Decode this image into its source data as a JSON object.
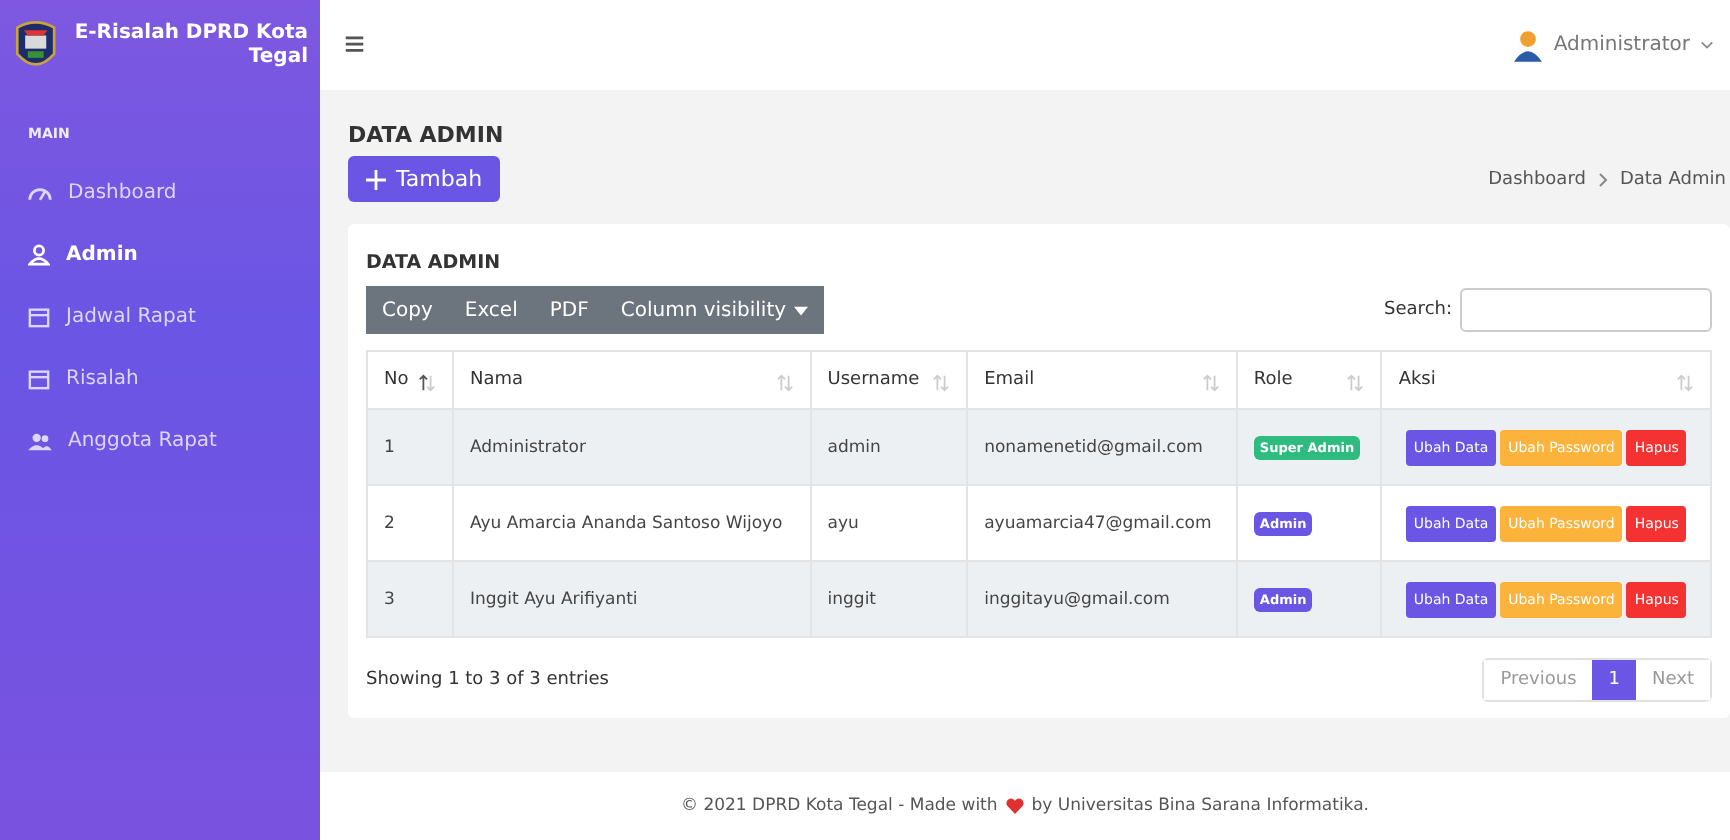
{
  "sidebar": {
    "brand": "E-Risalah DPRD Kota Tegal",
    "section": "MAIN",
    "items": [
      {
        "label": "Dashboard",
        "selected": false
      },
      {
        "label": "Admin",
        "selected": true
      },
      {
        "label": "Jadwal Rapat",
        "selected": false
      },
      {
        "label": "Risalah",
        "selected": false
      },
      {
        "label": "Anggota Rapat",
        "selected": false
      }
    ]
  },
  "topbar": {
    "menu_icon": "≡",
    "user": "Administrator"
  },
  "page": {
    "title": "DATA ADMIN",
    "add_button": "Tambah",
    "breadcrumb": [
      "Dashboard",
      "Data Admin"
    ]
  },
  "card": {
    "title": "DATA ADMIN",
    "export_buttons": [
      "Copy",
      "Excel",
      "PDF",
      "Column visibility"
    ],
    "search_label": "Search:",
    "columns": [
      {
        "label": "No",
        "sorted": true
      },
      {
        "label": "Nama",
        "sorted": false
      },
      {
        "label": "Username",
        "sorted": false
      },
      {
        "label": "Email",
        "sorted": false
      },
      {
        "label": "Role",
        "sorted": false
      },
      {
        "label": "Aksi",
        "sorted": false
      }
    ],
    "rows": [
      {
        "no": "1",
        "nama": "Administrator",
        "username": "admin",
        "email": "nonamenetid@gmail.com",
        "role": {
          "label": "Super Admin",
          "kind": "super"
        },
        "actions": [
          "Ubah Data",
          "Ubah Password",
          "Hapus"
        ]
      },
      {
        "no": "2",
        "nama": "Ayu Amarcia Ananda Santoso Wijoyo",
        "username": "ayu",
        "email": "ayuamarcia47@gmail.com",
        "role": {
          "label": "Admin",
          "kind": "admin"
        },
        "actions": [
          "Ubah Data",
          "Ubah Password",
          "Hapus"
        ]
      },
      {
        "no": "3",
        "nama": "Inggit Ayu Arifiyanti",
        "username": "inggit",
        "email": "inggitayu@gmail.com",
        "role": {
          "label": "Admin",
          "kind": "admin"
        },
        "actions": [
          "Ubah Data",
          "Ubah Password",
          "Hapus"
        ]
      }
    ],
    "info": "Showing 1 to 3 of 3 entries",
    "pagination": [
      {
        "label": "Previous",
        "selected": false
      },
      {
        "label": "1",
        "selected": true
      },
      {
        "label": "Next",
        "selected": false
      }
    ]
  },
  "footer": {
    "before": "© 2021 DPRD Kota Tegal - Made with",
    "after": "by Universitas Bina Sarana Informatika."
  }
}
